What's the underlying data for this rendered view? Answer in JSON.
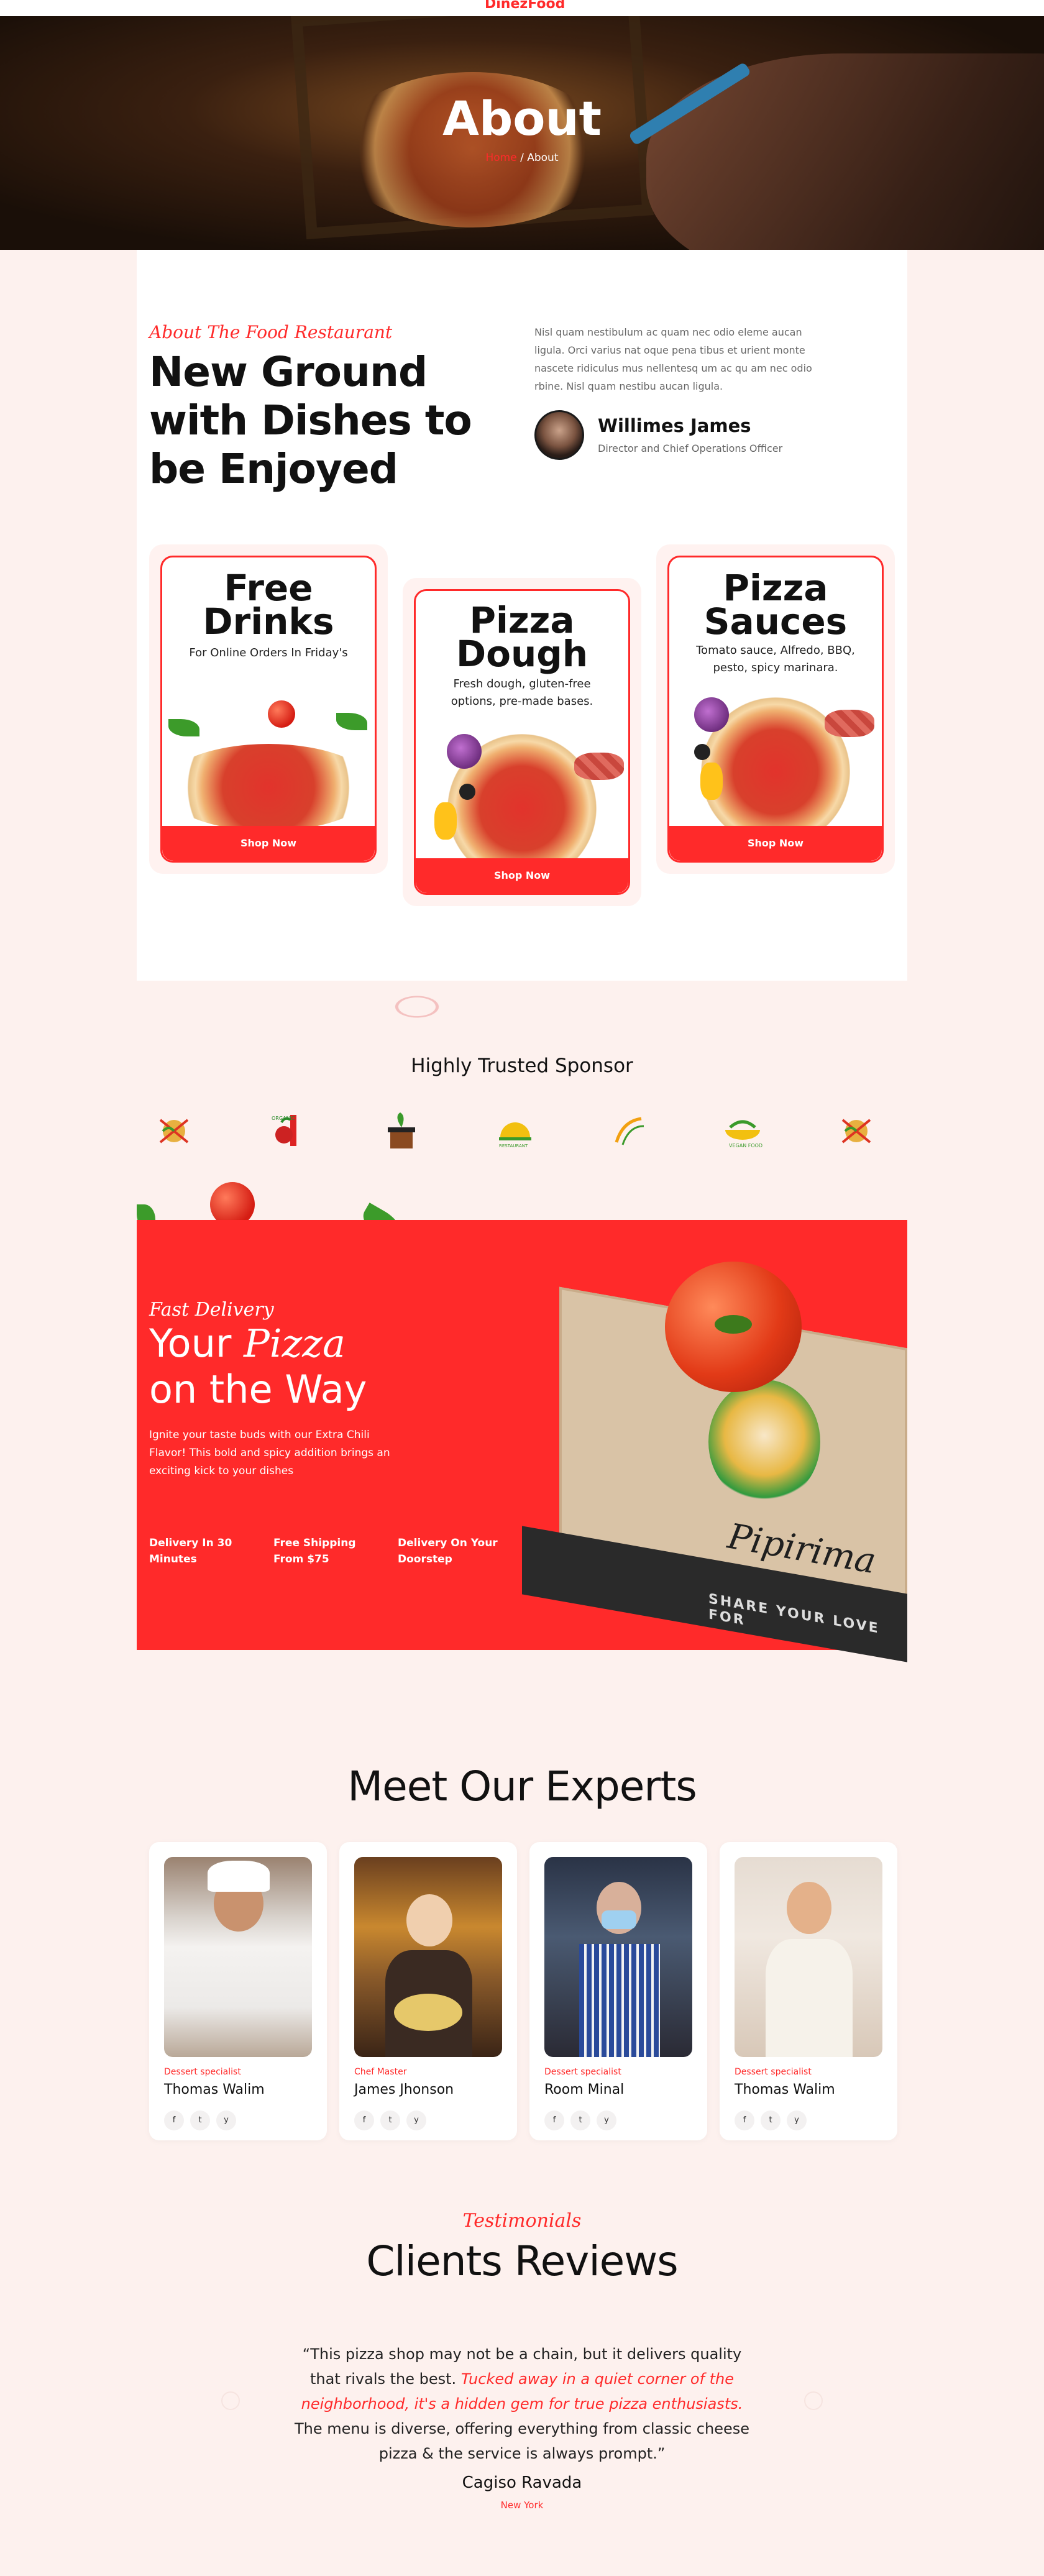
{
  "brand": {
    "name": "Dinez",
    "accent": "Food",
    "accent_color": "#ff2a2a"
  },
  "hero": {
    "title": "About",
    "breadcrumb_home": "Home",
    "breadcrumb_sep": "/",
    "breadcrumb_current": "About"
  },
  "about": {
    "tag": "About The Food Restaurant",
    "title": "New Ground with Dishes to be Enjoyed",
    "text": "Nisl quam nestibulum ac quam nec odio eleme aucan ligula. Orci varius nat oque pena tibus et urient monte nascete ridiculus mus nellentesq um ac qu am nec odio rbine. Nisl quam nestibu aucan ligula.",
    "author_name": "Willimes James",
    "author_role": "Director and Chief Operations Officer"
  },
  "promos": [
    {
      "title": "Free Drinks",
      "text": "For Online Orders In Friday's",
      "button": "Shop Now"
    },
    {
      "title": "Pizza Dough",
      "text": "Fresh dough, gluten-free options, pre-made bases.",
      "button": "Shop Now"
    },
    {
      "title": "Pizza Sauces",
      "text": "Tomato sauce, Alfredo, BBQ, pesto, spicy marinara.",
      "button": "Shop Now"
    }
  ],
  "sponsors": {
    "title": "Highly Trusted Sponsor",
    "logos": [
      "pizza-logo",
      "organic-food-logo",
      "plant-pot-logo",
      "restaurant-logo",
      "chef-logo",
      "vegan-food-logo",
      "pizza-logo"
    ]
  },
  "delivery": {
    "tag": "Fast Delivery",
    "title_line1_a": "Your ",
    "title_line1_b": "Pizza",
    "title_line2": "on the Way",
    "text": "Ignite your taste buds with our Extra Chili Flavor! This bold and spicy addition brings an exciting kick to your dishes",
    "features": [
      "Delivery In 30 Minutes",
      "Free Shipping From $75",
      "Delivery On Your Doorstep"
    ],
    "box_brand": "Pipirima",
    "box_side": "SHARE YOUR LOVE FOR"
  },
  "experts": {
    "title": "Meet Our Experts",
    "items": [
      {
        "role": "Dessert specialist",
        "name": "Thomas Walim"
      },
      {
        "role": "Chef Master",
        "name": "James Jhonson"
      },
      {
        "role": "Dessert specialist",
        "name": "Room Minal"
      },
      {
        "role": "Dessert specialist",
        "name": "Thomas Walim"
      }
    ],
    "social": [
      "f",
      "t",
      "y"
    ]
  },
  "testimonials": {
    "tag": "Testimonials",
    "title": "Clients Reviews",
    "quote_a": "“This pizza shop may not be a chain, but it delivers quality that rivals the best. ",
    "quote_highlight": "Tucked away in a quiet corner of the neighborhood, it's a hidden gem for true pizza enthusiasts.",
    "quote_b": " The menu is diverse, offering everything from classic cheese pizza & the service is always prompt.”",
    "name": "Cagiso Ravada",
    "location": "New York"
  }
}
